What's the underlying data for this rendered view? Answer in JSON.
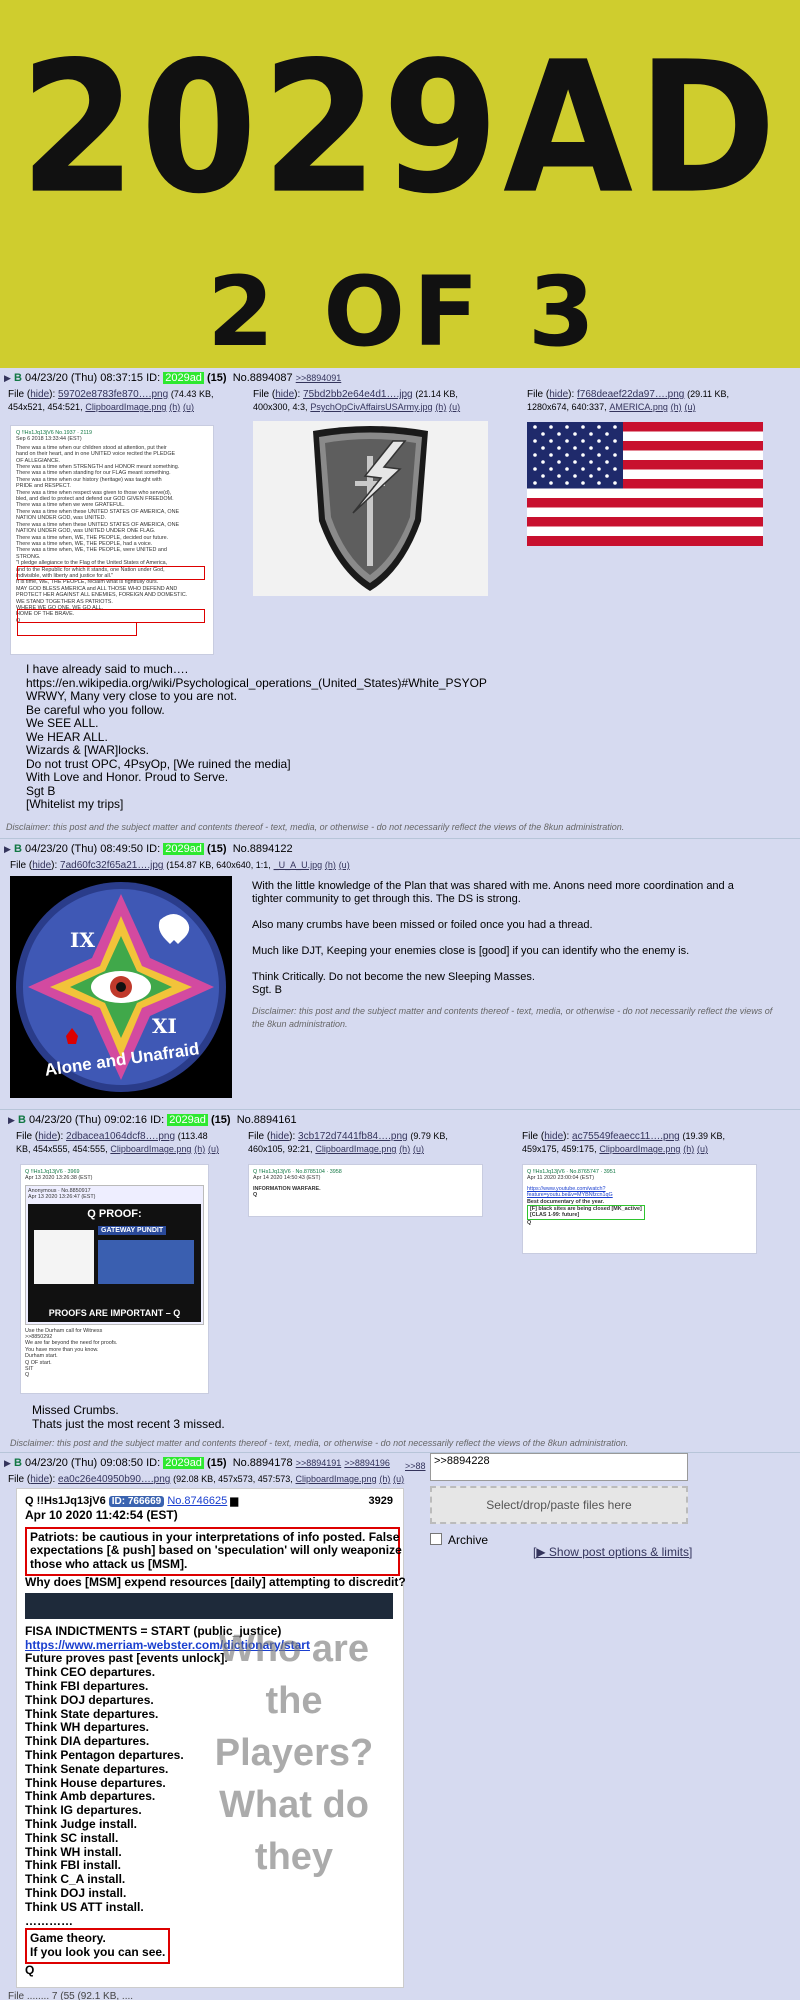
{
  "banner": {
    "title": "2029AD",
    "subtitle": "2 OF 3"
  },
  "common": {
    "board_letter": "B",
    "disclaimer": "Disclaimer: this post and the subject matter and contents thereof - text, media, or otherwise - do not necessarily reflect the views of the 8kun administration.",
    "file_label": "File",
    "hide": "hide",
    "h": "(h)",
    "u": "(u)"
  },
  "post1": {
    "date": "04/23/20 (Thu) 08:37:15",
    "id_label": "ID:",
    "id": "2029ad",
    "count": "(15)",
    "no": "No.8894087",
    "backlink": ">>8894091",
    "files": [
      {
        "name": "59702e8783fe870….png",
        "meta1": "(74.43 KB,",
        "meta2": "454x521, 454:521,",
        "orig": "ClipboardImage.png"
      },
      {
        "name": "75bd2bb2e64e4d1….jpg",
        "meta1": "(21.14 KB,",
        "meta2": "400x300, 4:3,",
        "orig": "PsychOpCivAffairsUSArmy.jpg"
      },
      {
        "name": "f768deaef22da97….png",
        "meta1": "(29.11 KB,",
        "meta2": "1280x674, 640:337,",
        "orig": "AMERICA.png"
      }
    ],
    "thumb1_header": "Q !!Hs1Jq13jV6 No.1937 · 2119",
    "thumb1_date": "Sep 6 2018 13:33:44 (EST)",
    "thumb1_lines": [
      "There was a time when our children stood at attention, put their",
      "hand on their heart, and in one UNITED voice recited the PLEDGE",
      "OF ALLEGIANCE.",
      "There was a time when STRENGTH and HONOR meant something.",
      "There was a time when standing for our FLAG meant something.",
      "There was a time when our history (heritage) was taught with",
      "PRIDE and RESPECT.",
      "There was a time when respect was given to those who serve(d),",
      "bled, and died to protect and defend our GOD GIVEN FREEDOM.",
      "There was a time when we were GRATEFUL.",
      "There was a time when these UNITED STATES OF AMERICA, ONE",
      "NATION UNDER GOD, was UNITED.",
      "There was a time when these UNITED STATES OF AMERICA, ONE",
      "NATION UNDER GOD, was UNITED UNDER ONE FLAG.",
      "There was a time when, WE, THE PEOPLE, decided our future.",
      "There was a time when, WE, THE PEOPLE, had a voice.",
      "There was a time when, WE, THE PEOPLE, were UNITED and",
      "STRONG.",
      "\"I pledge allegiance to the Flag of the United States of America,",
      "and to the Republic for which it stands, one Nation under God,",
      "indivisible, with liberty and justice for all.\"",
      "It is time, WE, THE PEOPLE, reclaim what is rightfully ours.",
      "MAY GOD BLESS AMERICA and ALL THOSE WHO DEFEND AND",
      "PROTECT HER AGAINST ALL ENEMIES, FOREIGN AND DOMESTIC.",
      "WE STAND TOGETHER AS PATRIOTS.",
      "WHERE WE GO ONE, WE GO ALL.",
      "HOME OF THE BRAVE.",
      "Q"
    ],
    "body": [
      "I have already said to much….",
      "https://en.wikipedia.org/wiki/Psychological_operations_(United_States)#White_PSYOP",
      "WRWY, Many very close to you are not.",
      "Be careful who you follow.",
      "We SEE ALL.",
      "We HEAR ALL.",
      "Wizards & [WAR]locks.",
      "Do not trust OPC, 4PsyOp, [We ruined the media]",
      "With Love and Honor. Proud to Serve.",
      "Sgt B",
      "[Whitelist my trips]"
    ]
  },
  "post2": {
    "date": "04/23/20 (Thu) 08:49:50",
    "id_label": "ID:",
    "id": "2029ad",
    "count": "(15)",
    "no": "No.8894122",
    "file": {
      "name": "7ad60fc32f65a21….jpg",
      "meta": "(154.87 KB, 640x640, 1:1,",
      "orig": "_U_A_U.jpg"
    },
    "patch_numerals": [
      "IX",
      "XI"
    ],
    "patch_text": "Alone and Unafraid",
    "body": [
      "With the little knowledge of the Plan that was shared with me. Anons need more coordination and a",
      "tighter community to get through this. The DS is strong.",
      "",
      "Also many crumbs have been missed or foiled once you had a thread.",
      "",
      "Much like DJT, Keeping your enemies close is [good] if you can identify who the enemy is.",
      "",
      "Think Critically. Do not become the new Sleeping Masses.",
      "Sgt. B"
    ],
    "disclaimer_lines": [
      "Disclaimer: this post and the subject matter and contents thereof - text, media, or otherwise - do not necessarily reflect the views of",
      "the 8kun administration."
    ]
  },
  "post3": {
    "date": "04/23/20 (Thu) 09:02:16",
    "id_label": "ID:",
    "id": "2029ad",
    "count": "(15)",
    "no": "No.8894161",
    "files": [
      {
        "name": "2dbacea1064dcf8….png",
        "meta1": "(113.48",
        "meta2": "KB, 454x555, 454:555,",
        "orig": "ClipboardImage.png"
      },
      {
        "name": "3cb172d7441fb84….png",
        "meta1": "(9.79 KB,",
        "meta2": "460x105, 92:21,",
        "orig": "ClipboardImage.png"
      },
      {
        "name": "ac75549feaecc11….png",
        "meta1": "(19.39 KB,",
        "meta2": "459x175, 459:175,",
        "orig": "ClipboardImage.png"
      }
    ],
    "t1": {
      "header": "Q !!Hs1Jq13jV6 · 3969",
      "date": "Apr 13 2020 13:26:38 (EST)",
      "inner_header": "Anonymous · No.8850917",
      "inner_date": "Apr 13 2020 13:26:47 (EST)",
      "proof_title": "Q PROOF:",
      "proof_sub": "GATEWAY PUNDIT",
      "caption": "PROOFS ARE IMPORTANT – Q",
      "lines": [
        "Use the Durham call for Witness",
        ">>8850292",
        "We are far beyond the need for proofs.",
        "You have more than you know.",
        "Durham start.",
        "Q OF start.",
        "SIT",
        "Q"
      ]
    },
    "t2": {
      "header": "Q !!Hs1Jq13jV6 · No.8785104 · 3958",
      "date": "Apr 14 2020 14:50:43 (EST)",
      "line": "INFORMATION WARFARE.",
      "q": "Q"
    },
    "t3": {
      "header": "Q !!Hs1Jq13jV6 · No.8765747 · 3951",
      "date": "Apr 11 2020 23:00:04 (EST)",
      "link1": "https://www.youtube.com/watch?",
      "link2": "feature=youtu.be&v=MYBNfzcn1qG",
      "line1": "Best documentary of the year.",
      "line2": "[F] black sites are being closed [MK_active]",
      "line3": "[CLAS 1-99: future]",
      "q": "Q"
    },
    "body": [
      "Missed Crumbs.",
      "Thats just the most recent 3 missed."
    ]
  },
  "post4": {
    "date": "04/23/20 (Thu) 09:08:50",
    "id_label": "ID:",
    "id": "2029ad",
    "count": "(15)",
    "no": "No.8894178",
    "backlinks": [
      ">>8894191",
      ">>8894196",
      ">>88"
    ],
    "file": {
      "name": "ea0c26e40950b90….png",
      "meta": "(92.08 KB, 457x573, 457:573,",
      "orig": "ClipboardImage.png"
    },
    "q": {
      "trip": "Q !!Hs1Jq13jV6",
      "id": "ID: 766669",
      "no": "No.8746625",
      "num": "3929",
      "date": "Apr 10 2020 11:42:54 (EST)",
      "boxed": [
        "Patriots: be cautious in your interpretations of info posted. False",
        "expectations [& push] based on 'speculation' will only weaponize",
        "those who attack us [MSM]."
      ],
      "question": "Why does [MSM] expend resources [daily] attempting to discredit?",
      "fisa": "FISA INDICTMENTS = START (public_justice)",
      "link": "https://www.merriam-webster.com/dictionary/start",
      "future": "Future proves past [events unlock].",
      "list": [
        "Think CEO departures.",
        "Think FBI departures.",
        "Think DOJ departures.",
        "Think State departures.",
        "Think WH departures.",
        "Think DIA departures.",
        "Think Pentagon departures.",
        "Think Senate departures.",
        "Think House departures.",
        "Think Amb departures.",
        "Think IG departures.",
        "Think Judge install.",
        "Think SC install.",
        "Think WH install.",
        "Think FBI install.",
        "Think C_A install.",
        "Think DOJ install.",
        "Think US ATT install."
      ],
      "dots": "…………",
      "game": [
        "Game theory.",
        "If you look you can see."
      ],
      "sig": "Q"
    },
    "overlay": [
      "Who are",
      "the",
      "Players?",
      "What do",
      "they"
    ],
    "form": {
      "textarea_value": ">>8894228",
      "drop_label": "Select/drop/paste files here",
      "archive_label": "Archive",
      "options_link": "[▶ Show post options & limits]"
    },
    "cut_file": "File ........ 7 (55 (92.1 KB, ...."
  },
  "colors": {
    "bg": "#d6daf0",
    "banner": "#cfcd2e",
    "id_green": "#2ee830",
    "name_green": "#117743",
    "link": "#34345c",
    "red": "#d00000"
  }
}
